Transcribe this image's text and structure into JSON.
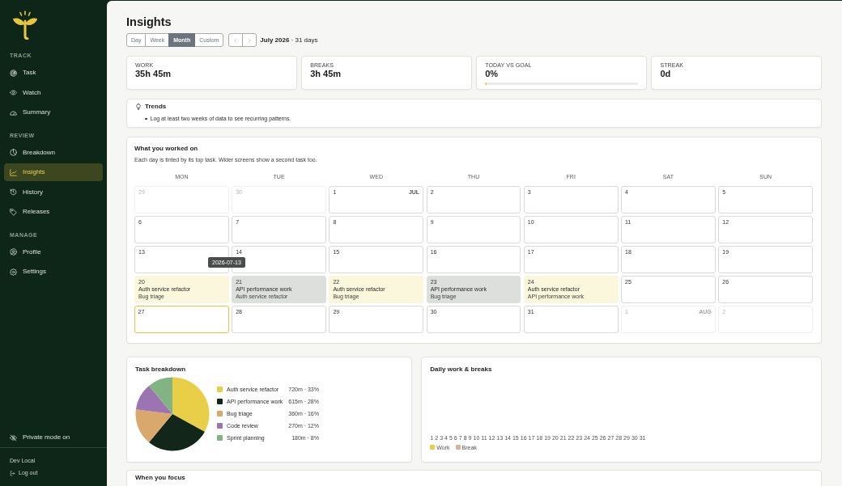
{
  "sidebar": {
    "sections": [
      {
        "label": "TRACK",
        "items": [
          {
            "label": "Task",
            "selected": false
          },
          {
            "label": "Watch",
            "selected": false
          },
          {
            "label": "Summary",
            "selected": false
          }
        ]
      },
      {
        "label": "REVIEW",
        "items": [
          {
            "label": "Breakdown",
            "selected": false
          },
          {
            "label": "Insights",
            "selected": true
          },
          {
            "label": "History",
            "selected": false
          },
          {
            "label": "Releases",
            "selected": false
          }
        ]
      },
      {
        "label": "MANAGE",
        "items": [
          {
            "label": "Profile",
            "selected": false
          },
          {
            "label": "Settings",
            "selected": false
          }
        ]
      }
    ],
    "private_mode": {
      "label": "Private mode on"
    },
    "user": {
      "name": "Dev Local"
    },
    "logout": {
      "label": "Log out"
    }
  },
  "header": {
    "title": "Insights",
    "ranges": [
      {
        "label": "Day",
        "selected": false
      },
      {
        "label": "Week",
        "selected": false
      },
      {
        "label": "Month",
        "selected": true
      },
      {
        "label": "Custom",
        "selected": false
      }
    ],
    "period": "**July 2026** · 31 days"
  },
  "stats": [
    {
      "kind": "total",
      "label": "WORK",
      "value": "35h 45m"
    },
    {
      "kind": "total",
      "label": "BREAKS",
      "value": "3h 45m"
    },
    {
      "kind": "goal",
      "label": "TODAY VS GOAL",
      "value": "0%",
      "level": 0
    },
    {
      "kind": "total",
      "label": "STREAK",
      "value": "0d"
    }
  ],
  "trends": {
    "title": "Trends",
    "items": [
      "Log at least two weeks of data to see recurring patterns."
    ]
  },
  "calendar": {
    "title": "What you worked on",
    "subtitle": "Each day is tinted by its top task. Wider screens show a second task too.",
    "weekdays": [
      "MON",
      "TUE",
      "WED",
      "THU",
      "FRI",
      "SAT",
      "SUN"
    ],
    "weeks": [
      [
        {
          "day": "29",
          "outside": true,
          "today": false
        },
        {
          "day": "30",
          "outside": true,
          "today": false
        },
        {
          "day": "1",
          "outside": false,
          "today": false,
          "month_label": "JUL"
        },
        {
          "day": "2",
          "outside": false,
          "today": false
        },
        {
          "day": "3",
          "outside": false,
          "today": false
        },
        {
          "day": "4",
          "outside": false,
          "today": false
        },
        {
          "day": "5",
          "outside": false,
          "today": false
        }
      ],
      [
        {
          "day": "6",
          "outside": false,
          "today": false
        },
        {
          "day": "7",
          "outside": false,
          "today": false
        },
        {
          "day": "8",
          "outside": false,
          "today": false
        },
        {
          "day": "9",
          "outside": false,
          "today": false
        },
        {
          "day": "10",
          "outside": false,
          "today": false
        },
        {
          "day": "11",
          "outside": false,
          "today": false
        },
        {
          "day": "12",
          "outside": false,
          "today": false
        }
      ],
      [
        {
          "day": "13",
          "outside": false,
          "today": false,
          "tooltip": "2026-07-13"
        },
        {
          "day": "14",
          "outside": false,
          "today": false
        },
        {
          "day": "15",
          "outside": false,
          "today": false
        },
        {
          "day": "16",
          "outside": false,
          "today": false
        },
        {
          "day": "17",
          "outside": false,
          "today": false
        },
        {
          "day": "18",
          "outside": false,
          "today": false
        },
        {
          "day": "19",
          "outside": false,
          "today": false
        }
      ],
      [
        {
          "day": "20",
          "outside": false,
          "today": false,
          "color": "#faf7dc",
          "tasks": [
            "Auth service refactor",
            "Bug triage"
          ]
        },
        {
          "day": "21",
          "outside": false,
          "today": false,
          "color": "#dddfdc",
          "tasks": [
            "API performance work",
            "Auth service refactor"
          ]
        },
        {
          "day": "22",
          "outside": false,
          "today": false,
          "color": "#faf7dc",
          "tasks": [
            "Auth service refactor",
            "Bug triage"
          ]
        },
        {
          "day": "23",
          "outside": false,
          "today": false,
          "color": "#dddfdc",
          "tasks": [
            "API performance work",
            "Bug triage"
          ]
        },
        {
          "day": "24",
          "outside": false,
          "today": false,
          "color": "#faf7dc",
          "tasks": [
            "Auth service refactor",
            "API performance work"
          ]
        },
        {
          "day": "25",
          "outside": false,
          "today": false
        },
        {
          "day": "26",
          "outside": false,
          "today": false
        }
      ],
      [
        {
          "day": "27",
          "outside": false,
          "today": true
        },
        {
          "day": "28",
          "outside": false,
          "today": false
        },
        {
          "day": "29",
          "outside": false,
          "today": false
        },
        {
          "day": "30",
          "outside": false,
          "today": false
        },
        {
          "day": "31",
          "outside": false,
          "today": false
        },
        {
          "day": "1",
          "outside": true,
          "today": false,
          "month_label": "AUG"
        },
        {
          "day": "2",
          "outside": true,
          "today": false
        }
      ]
    ]
  },
  "task_breakdown": {
    "title": "Task breakdown",
    "chart_data": {
      "type": "pie",
      "categories": [
        "Auth service refactor",
        "API performance work",
        "Bug triage",
        "Code review",
        "Sprint planning"
      ],
      "values": [
        33,
        28,
        16,
        12,
        11
      ]
    },
    "legend": [
      {
        "color": "#e9cf48",
        "reading": "720m · 33%"
      },
      {
        "color": "#13261a",
        "reading": "615m · 28%"
      },
      {
        "color": "#d9a86c",
        "reading": "360m · 16%"
      },
      {
        "color": "#9b74b1",
        "reading": "270m · 12%"
      },
      {
        "color": "#82b383",
        "reading": "180m · 8%"
      }
    ]
  },
  "daily_chart": {
    "title": "Daily work & breaks",
    "day_labels": [
      "1",
      "2",
      "3",
      "4",
      "5",
      "6",
      "7",
      "8",
      "9",
      "10",
      "11",
      "12",
      "13",
      "14",
      "15",
      "16",
      "17",
      "18",
      "19",
      "20",
      "21",
      "22",
      "23",
      "24",
      "25",
      "26",
      "27",
      "28",
      "29",
      "30",
      "31"
    ],
    "legend": [
      {
        "label": "Work",
        "color": "#e9cf48"
      },
      {
        "label": "Break",
        "color": "#d8b29b"
      }
    ]
  },
  "focus": {
    "title": "When you focus"
  }
}
